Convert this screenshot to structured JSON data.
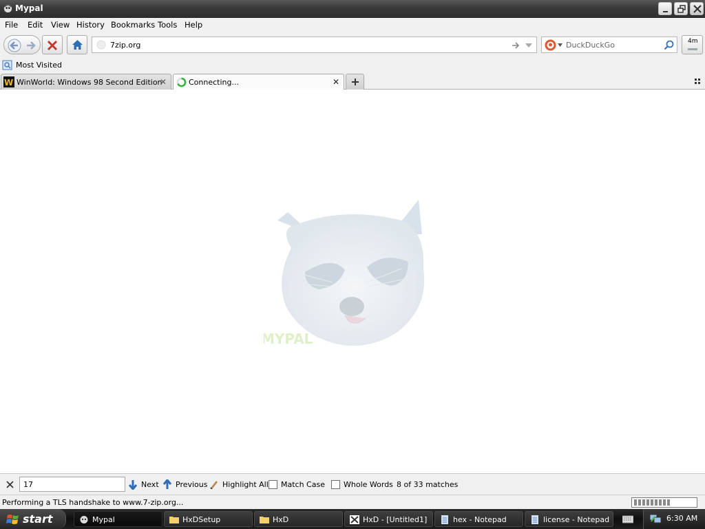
{
  "window": {
    "title": "Mypal"
  },
  "menu": [
    "File",
    "Edit",
    "View",
    "History",
    "Bookmarks",
    "Tools",
    "Help"
  ],
  "url": "7zip.org",
  "search": {
    "placeholder": "DuckDuckGo",
    "engine_icon": "duckduckgo-icon"
  },
  "downloads_badge": "4m",
  "bookmarks": [
    {
      "label": "Most Visited"
    }
  ],
  "tabs": [
    {
      "label": "WinWorld: Windows 98 Second Edition",
      "icon": "winworld-icon",
      "active": false
    },
    {
      "label": "Connecting...",
      "icon": "loading-spinner-icon",
      "active": true
    }
  ],
  "watermark": {
    "text": "MYPAL"
  },
  "find": {
    "value": "17",
    "next_label": "Next",
    "previous_label": "Previous",
    "highlight_label": "Highlight All",
    "match_case_label": "Match Case",
    "whole_words_label": "Whole Words",
    "status": "8 of 33 matches"
  },
  "status": {
    "text": "Performing a TLS handshake to www.7-zip.org..."
  },
  "taskbar": {
    "start_label": "start",
    "tasks": [
      {
        "label": "Mypal",
        "active": true
      },
      {
        "label": "HxDSetup",
        "active": false
      },
      {
        "label": "HxD",
        "active": false
      },
      {
        "label": "HxD - [Untitled1]",
        "active": false
      },
      {
        "label": "hex - Notepad",
        "active": false
      },
      {
        "label": "license - Notepad",
        "active": false
      }
    ],
    "clock": "6:30 AM"
  },
  "colors": {
    "titlebar": "#3a3a3a",
    "chrome": "#f0f0f0",
    "taskbar": "#1d1d1d",
    "watermark": "#a8c898"
  }
}
